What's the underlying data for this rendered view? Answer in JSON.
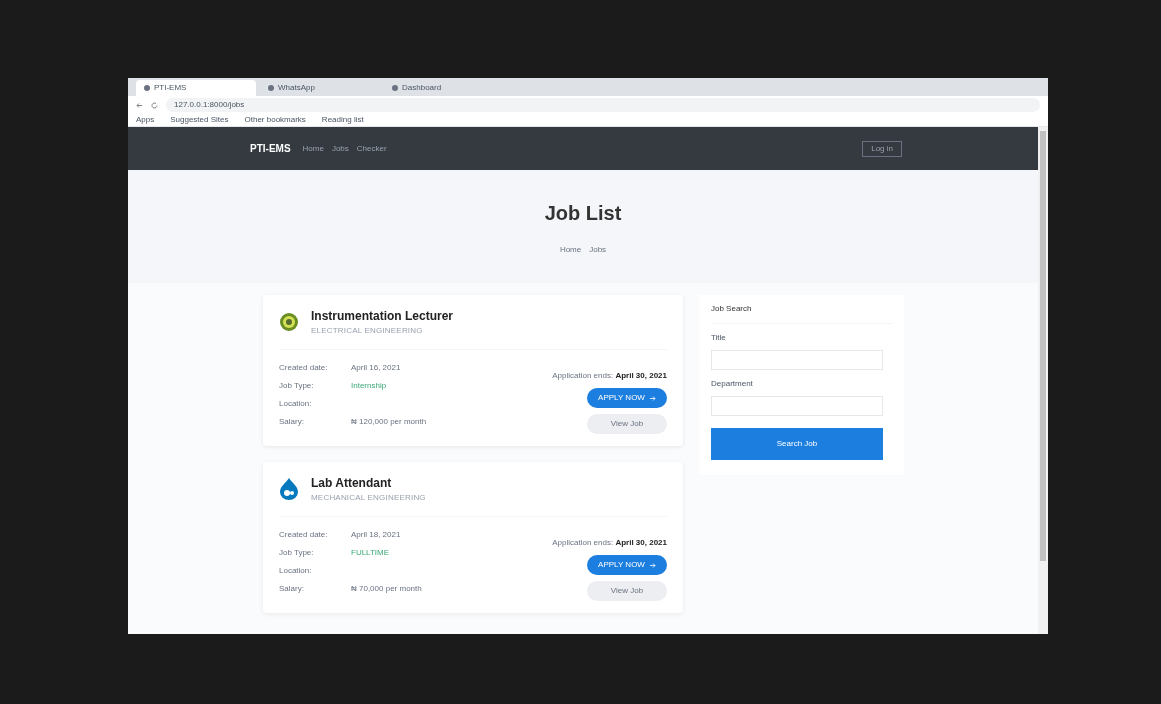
{
  "browser": {
    "tabs": [
      {
        "title": "PTI-EMS",
        "selected": true
      },
      {
        "title": "WhatsApp",
        "selected": false
      },
      {
        "title": "Dashboard",
        "selected": false
      }
    ],
    "url": "127.0.0.1:8000/jobs",
    "bookmarks": [
      "Apps",
      "Suggested Sites",
      "Other bookmarks",
      "Reading list"
    ]
  },
  "navbar": {
    "brand": "PTI-EMS",
    "links": [
      "Home",
      "Jobs",
      "Checker"
    ],
    "login": "Log in"
  },
  "header": {
    "title": "Job List",
    "breadcrumb": [
      "Home",
      "Jobs"
    ]
  },
  "jobs": [
    {
      "title": "Instrumentation Lecturer",
      "department": "ELECTRICAL ENGINEERING",
      "kind": "badge",
      "fields": [
        {
          "label": "Created date:",
          "value": "April 16, 2021"
        },
        {
          "label": "Job Type:",
          "value": "Internship",
          "kind": "type"
        },
        {
          "label": "Location:"
        },
        {
          "label": "Salary:",
          "value": "₦ 120,000 per month"
        }
      ],
      "ends_label": "Application ends:",
      "ends": "April 30, 2021",
      "apply": "APPLY NOW",
      "view": "View Job"
    },
    {
      "title": "Lab Attendant",
      "department": "MECHANICAL ENGINEERING",
      "kind": "drop",
      "fields": [
        {
          "label": "Created date:",
          "value": "April 18, 2021"
        },
        {
          "label": "Job Type:",
          "value": "FULLTIME",
          "kind": "type"
        },
        {
          "label": "Location:"
        },
        {
          "label": "Salary:",
          "value": "₦ 70,000 per month"
        }
      ],
      "ends_label": "Application ends:",
      "ends": "April 30, 2021",
      "apply": "APPLY NOW",
      "view": "View Job"
    }
  ],
  "search": {
    "heading": "Job Search",
    "fields": [
      "Title",
      "Department"
    ],
    "button": "Search Job"
  }
}
